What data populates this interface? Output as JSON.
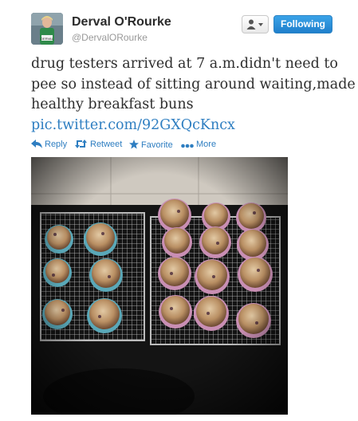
{
  "user": {
    "name": "Derval O'Rourke",
    "handle": "@DervalORourke",
    "bib_text": "DERVAL"
  },
  "buttons": {
    "follow_label": "Following"
  },
  "tweet": {
    "text_lines": [
      "drug testers arrived at 7 a.m.didn't need to",
      "pee so instead of sitting around waiting,made",
      "healthy breakfast buns"
    ],
    "link": "pic.twitter.com/92GXQcKncx"
  },
  "actions": {
    "reply": "Reply",
    "retweet": "Retweet",
    "favorite": "Favorite",
    "more": "More"
  },
  "colors": {
    "link": "#2e7ec1",
    "follow_button": "#2a8ed8"
  },
  "icons": {
    "user_menu": "user-dropdown-icon",
    "reply": "reply-arrow-icon",
    "retweet": "retweet-icon",
    "favorite": "star-icon",
    "more": "more-dots-icon"
  }
}
